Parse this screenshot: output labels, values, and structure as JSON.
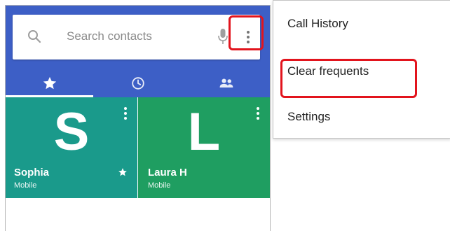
{
  "search": {
    "placeholder": "Search contacts"
  },
  "tabs": [
    {
      "icon": "star-icon",
      "selected": true
    },
    {
      "icon": "clock-icon",
      "selected": false
    },
    {
      "icon": "people-icon",
      "selected": false
    }
  ],
  "favorites": [
    {
      "letter": "S",
      "name": "Sophia",
      "type": "Mobile",
      "color": "#1a9a8b",
      "starred": true
    },
    {
      "letter": "L",
      "name": "Laura H",
      "type": "Mobile",
      "color": "#1f9e61",
      "starred": false
    }
  ],
  "overflow_menu": {
    "items": [
      {
        "label": "Call History"
      },
      {
        "label": "Clear frequents"
      },
      {
        "label": "Settings"
      }
    ]
  },
  "colors": {
    "appbar": "#3d5fc6",
    "highlight": "#e2141d"
  }
}
